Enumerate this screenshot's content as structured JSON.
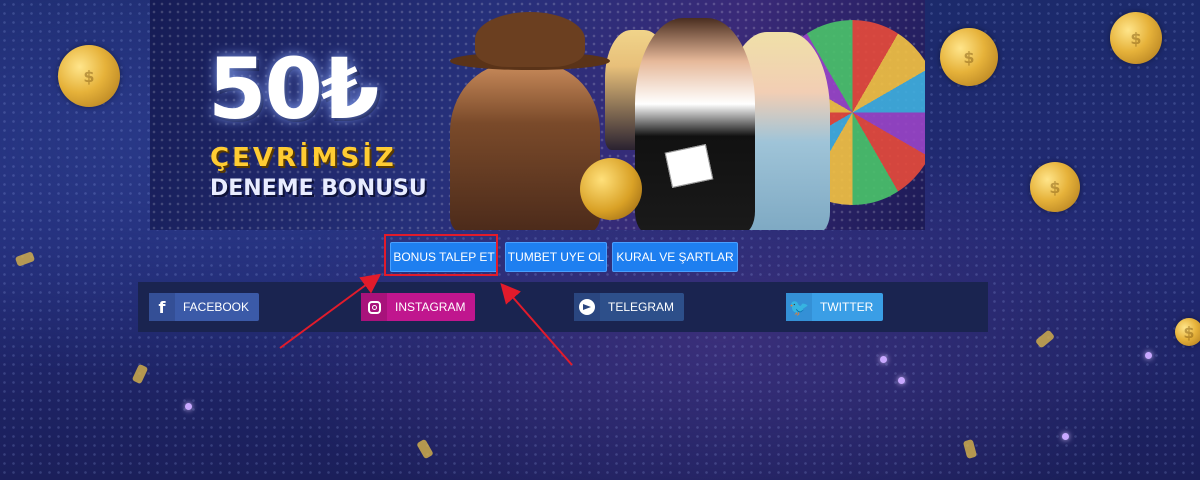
{
  "banner": {
    "amount": "50₺",
    "line1": "ÇEVRİMSİZ",
    "line2": "DENEME BONUSU"
  },
  "buttons": {
    "bonus_request": "BONUS TALEP ET",
    "signup": "TUMBET UYE OL",
    "rules": "KURAL VE ŞARTLAR"
  },
  "social": {
    "facebook": {
      "label": "FACEBOOK",
      "icon": "facebook-icon",
      "color": "#3b5aa8"
    },
    "instagram": {
      "label": "INSTAGRAM",
      "icon": "instagram-icon",
      "color": "#c0168e"
    },
    "telegram": {
      "label": "TELEGRAM",
      "icon": "telegram-icon",
      "color": "#2d4f8a"
    },
    "twitter": {
      "label": "TWITTER",
      "icon": "twitter-icon",
      "color": "#3a9ee6"
    }
  },
  "colors": {
    "button_blue": "#1e7ff0",
    "highlight_red": "#e21b2b",
    "banner_gold": "#ffcc33"
  }
}
